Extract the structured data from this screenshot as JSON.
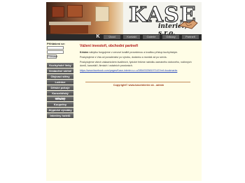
{
  "header": {
    "logo_text": "KASE",
    "logo_subtitle": "interiér, s.r.o."
  },
  "nav": {
    "items": [
      "Úvod",
      "Kontakt",
      "Galerie",
      "Odkazy",
      "Partneři"
    ]
  },
  "login": {
    "label": "Přihlášení se:",
    "button": "Přihlásit"
  },
  "menu": {
    "items": [
      "Kuchyňské linky",
      "Vestavěné skříně",
      "Obývací stěny",
      "Ložnice",
      "Dětské pokoje",
      "Kancelářský nábytek",
      "Schody",
      "Koupelny",
      "Atypické výrobky",
      "Interiéry hotelů"
    ]
  },
  "main": {
    "title": "Vážení investoři, obchodní partneři",
    "para1_bold": "Kristen",
    "para1": " nábytku fungujeme v cenové kvalitě provedenou a kvalitou přístup kuchyňským.",
    "para2": "Poskytujeme s Vás od poradenství po výrobu, dodávku a montáž až po servis.",
    "para3": "Poskytujeme všech zákaznickém kvalitních, fyzické řešíme nabídku zamáného dobového, rodinných domů, kanceláří, firmách i ostatních prostorách.",
    "link": "https://www.facebook.com/pages/Kase-interier-s-r-o/285433258197143?ref=bookmarks"
  },
  "footer": {
    "copyright": "Copyright© www.kaseinterier.sk - admin"
  }
}
